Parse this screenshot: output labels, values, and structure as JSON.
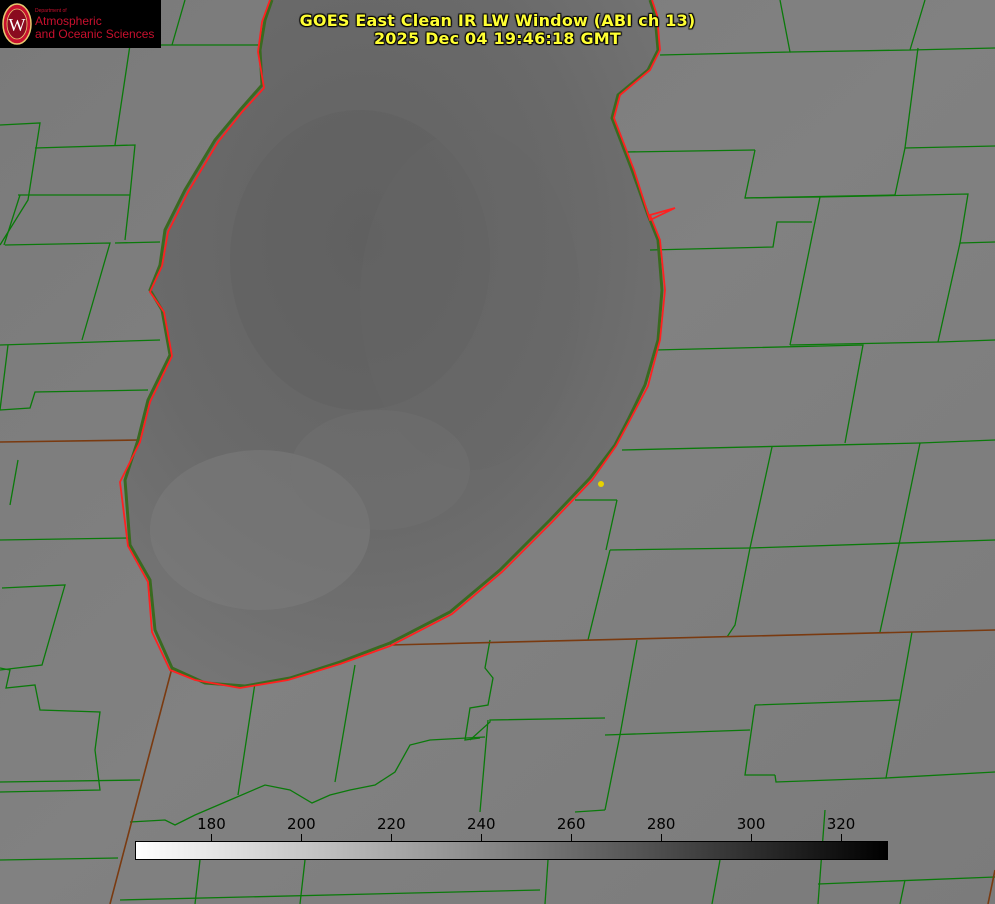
{
  "title": {
    "line1": "GOES East Clean IR LW Window (ABI ch 13)",
    "line2": "2025 Dec 04 19:46:18 GMT"
  },
  "logo": {
    "dept": "Department of",
    "line1": "Atmospheric",
    "line2": "and Oceanic Sciences",
    "seal_letter": "W",
    "color": "#c8102e"
  },
  "colorbar": {
    "units_min": 163,
    "units_max": 330,
    "ticks": [
      "180",
      "200",
      "220",
      "240",
      "260",
      "280",
      "300",
      "320"
    ],
    "gradient": [
      "#ffffff",
      "#000000"
    ]
  },
  "colors": {
    "background": "#7d7d7d",
    "lake": "#6b6b6b",
    "county_lines": "#0a7a0a",
    "state_lines": "#8a3a1a",
    "shoreline": "#ff2020",
    "title": "#ffff33",
    "marker": "#e6d200"
  }
}
